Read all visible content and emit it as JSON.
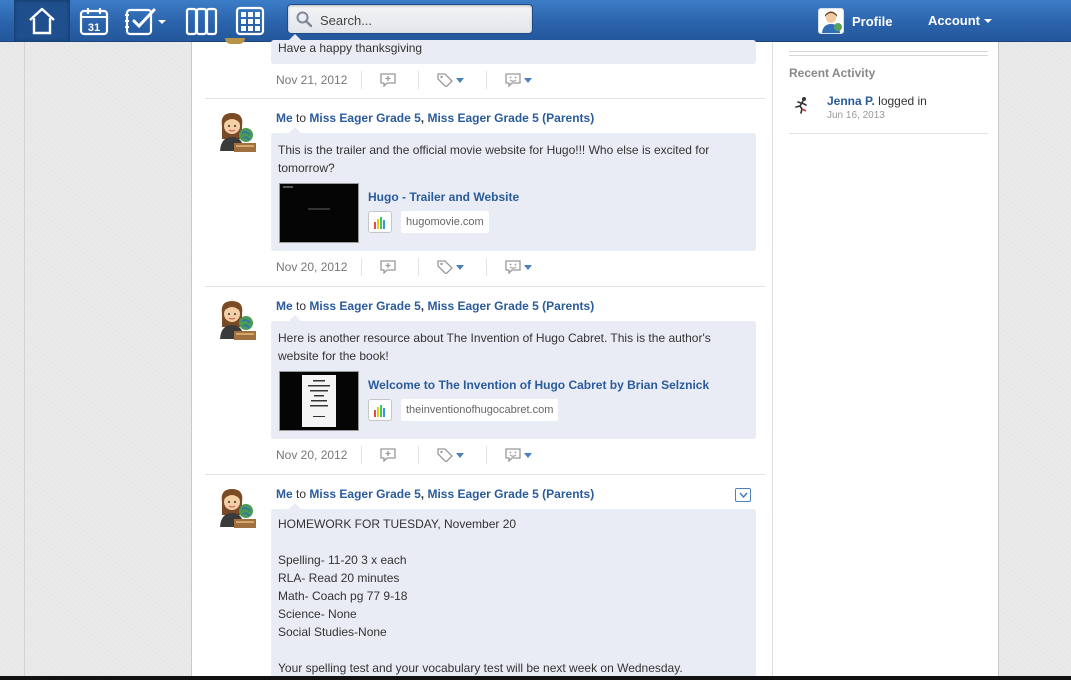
{
  "nav": {
    "items": [
      {
        "name": "home-icon"
      },
      {
        "name": "calendar-icon",
        "label": "31"
      },
      {
        "name": "assignments-icon"
      },
      {
        "name": "resources-icon"
      },
      {
        "name": "apps-grid-icon"
      }
    ]
  },
  "search": {
    "placeholder": "Search..."
  },
  "header": {
    "profile_label": "Profile",
    "account_label": "Account"
  },
  "colors": {
    "topbar": "#2a62aa",
    "link": "#2a5b9c",
    "bubble": "#e9ecf4"
  },
  "posts": [
    {
      "text": "Have a happy thanksgiving",
      "date": "Nov 21, 2012"
    },
    {
      "sender": "Me",
      "to_word": "to",
      "group1": "Miss Eager Grade 5",
      "comma": ",",
      "group2": "Miss Eager Grade 5 (Parents)",
      "text": "This is the trailer and the official movie website for Hugo!!! Who else is excited for tomorrow?",
      "link_title": "Hugo - Trailer and Website",
      "link_domain": "hugomovie.com",
      "date": "Nov 20, 2012"
    },
    {
      "sender": "Me",
      "to_word": "to",
      "group1": "Miss Eager Grade 5",
      "comma": ",",
      "group2": "Miss Eager Grade 5 (Parents)",
      "text": "Here is another resource about The Invention of Hugo Cabret. This is the author's website for the book!",
      "link_title": "Welcome to The Invention of Hugo Cabret by Brian Selznick",
      "link_domain": "theinventionofhugocabret.com",
      "date": "Nov 20, 2012"
    },
    {
      "sender": "Me",
      "to_word": "to",
      "group1": "Miss Eager Grade 5",
      "comma": ",",
      "group2": "Miss Eager Grade 5 (Parents)",
      "lines": [
        "HOMEWORK FOR TUESDAY, November 20",
        "",
        "Spelling- 11-20 3 x each",
        "RLA- Read 20 minutes",
        "Math- Coach pg 77 9-18",
        "Science- None",
        "Social Studies-None",
        "",
        "Your spelling test and your vocabulary test will be next week on Wednesday."
      ]
    }
  ],
  "sidebar": {
    "recent_title": "Recent Activity",
    "activity": {
      "user": "Jenna P.",
      "action": " logged in",
      "date": "Jun 16, 2013"
    }
  }
}
